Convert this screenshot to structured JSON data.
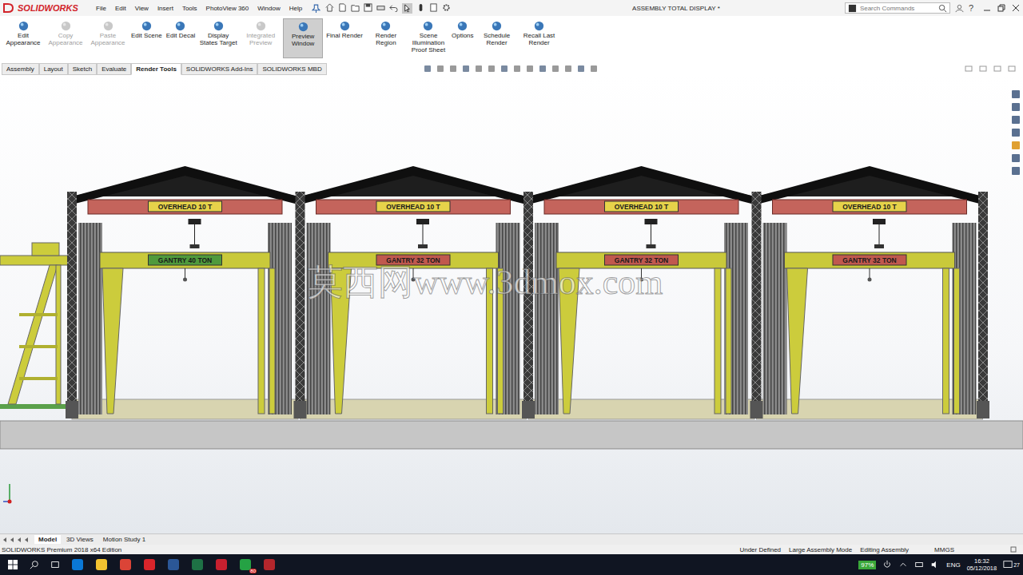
{
  "app": {
    "logo": "SOLIDWORKS",
    "title": "ASSEMBLY TOTAL DISPLAY *",
    "help": "?"
  },
  "menu": [
    "File",
    "Edit",
    "View",
    "Insert",
    "Tools",
    "PhotoView 360",
    "Window",
    "Help"
  ],
  "search": {
    "placeholder": "Search Commands"
  },
  "ribbon": [
    {
      "label": "Edit Appearance",
      "disabled": false,
      "selected": false
    },
    {
      "label": "Copy Appearance",
      "disabled": true,
      "selected": false
    },
    {
      "label": "Paste Appearance",
      "disabled": true,
      "selected": false
    },
    {
      "label": "Edit Scene",
      "disabled": false,
      "selected": false
    },
    {
      "label": "Edit Decal",
      "disabled": false,
      "selected": false
    },
    {
      "label": "Display States Target",
      "disabled": false,
      "selected": false
    },
    {
      "label": "Integrated Preview",
      "disabled": true,
      "selected": false
    },
    {
      "label": "Preview Window",
      "disabled": false,
      "selected": true
    },
    {
      "label": "Final Render",
      "disabled": false,
      "selected": false
    },
    {
      "label": "Render Region",
      "disabled": false,
      "selected": false
    },
    {
      "label": "Scene Illumination Proof Sheet",
      "disabled": false,
      "selected": false
    },
    {
      "label": "Options",
      "disabled": false,
      "selected": false
    },
    {
      "label": "Schedule Render",
      "disabled": false,
      "selected": false
    },
    {
      "label": "Recall Last Render",
      "disabled": false,
      "selected": false
    }
  ],
  "tabs": [
    {
      "label": "Assembly",
      "selected": false
    },
    {
      "label": "Layout",
      "selected": false
    },
    {
      "label": "Sketch",
      "selected": false
    },
    {
      "label": "Evaluate",
      "selected": false
    },
    {
      "label": "Render Tools",
      "selected": true
    },
    {
      "label": "SOLIDWORKS Add-Ins",
      "selected": false
    },
    {
      "label": "SOLIDWORKS MBD",
      "selected": false
    }
  ],
  "model": {
    "bays": [
      {
        "overhead": "OVERHEAD 10 T",
        "gantry": "GANTRY 40 TON",
        "color": "#4f9a3c"
      },
      {
        "overhead": "OVERHEAD 10 T",
        "gantry": "GANTRY 32 TON",
        "color": "#c0584e"
      },
      {
        "overhead": "OVERHEAD 10 T",
        "gantry": "GANTRY 32 TON",
        "color": "#c0584e"
      },
      {
        "overhead": "OVERHEAD 10 T",
        "gantry": "GANTRY 32 TON",
        "color": "#c0584e"
      }
    ]
  },
  "watermark": "莫西网www.3dmox.com",
  "bottom_tabs": [
    {
      "label": "Model",
      "selected": true
    },
    {
      "label": "3D Views",
      "selected": false
    },
    {
      "label": "Motion Study 1",
      "selected": false
    }
  ],
  "status": {
    "edition": "SOLIDWORKS Premium 2018 x64 Edition",
    "items": [
      "Under Defined",
      "Large Assembly Mode",
      "Editing Assembly",
      "MMGS"
    ]
  },
  "taskbar": {
    "battery": "97%",
    "language": "ENG",
    "time": "16:32",
    "date": "05/12/2018",
    "notifications": "27",
    "app_badge": "80"
  }
}
